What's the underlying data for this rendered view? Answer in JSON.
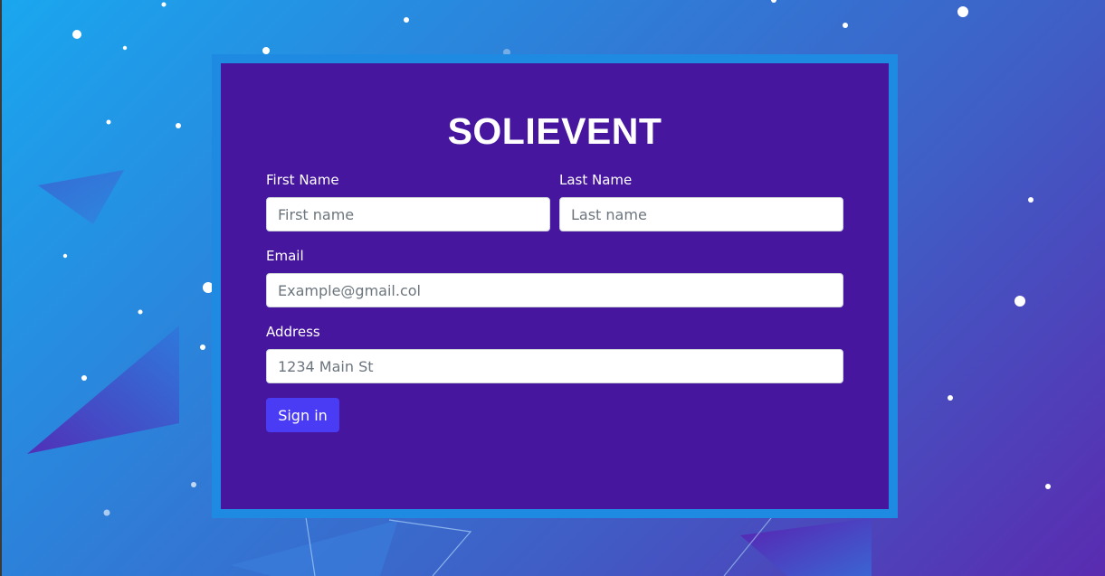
{
  "brand": {
    "title": "SOLIEVENT"
  },
  "form": {
    "first_name": {
      "label": "First Name",
      "placeholder": "First name",
      "value": ""
    },
    "last_name": {
      "label": "Last Name",
      "placeholder": "Last name",
      "value": ""
    },
    "email": {
      "label": "Email",
      "placeholder": "Example@gmail.col",
      "value": ""
    },
    "address": {
      "label": "Address",
      "placeholder": "1234 Main St",
      "value": ""
    },
    "submit_label": "Sign in"
  },
  "colors": {
    "background_start": "#1aa7ef",
    "background_end": "#5a2bb0",
    "card_frame": "#1f8ae2",
    "card": "#46169f",
    "button": "#4a3cf5",
    "text": "#ffffff"
  }
}
